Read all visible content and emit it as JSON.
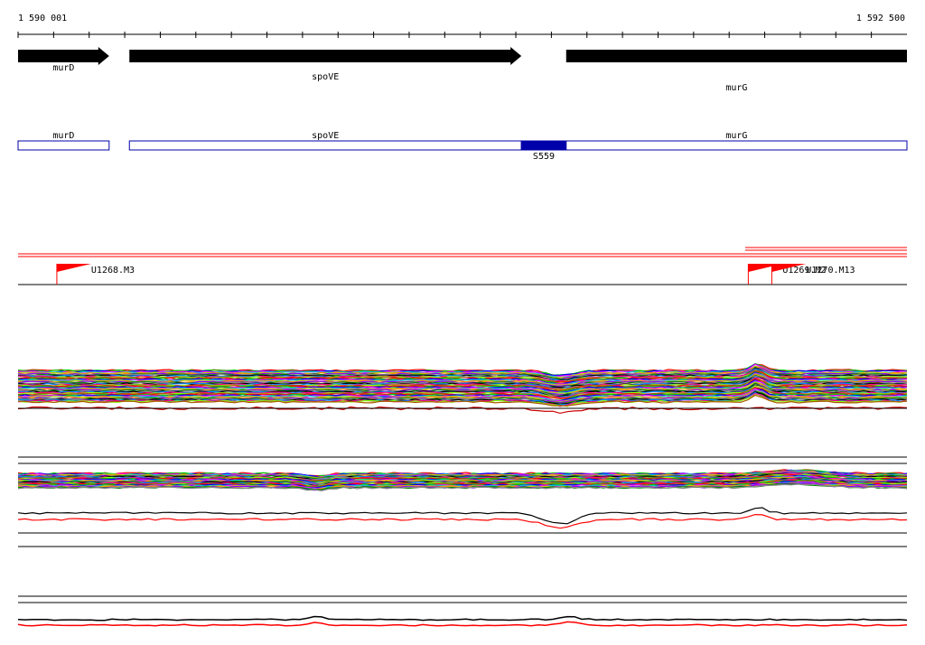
{
  "ruler": {
    "start_label": "1 590 001",
    "end_label": "1 592 500",
    "start": 1590001,
    "end": 1592500
  },
  "genes": [
    {
      "name": "murD",
      "start": 1590001,
      "end": 1590257,
      "strand": "+"
    },
    {
      "name": "spoVE",
      "start": 1590314,
      "end": 1591416,
      "strand": "+"
    },
    {
      "name": "murG",
      "start": 1591542,
      "end": 1592500,
      "strand": "+"
    }
  ],
  "segments": [
    {
      "name": "murD",
      "start": 1590001,
      "end": 1590257,
      "filled": false
    },
    {
      "name": "spoVE",
      "start": 1590314,
      "end": 1591416,
      "filled": false
    },
    {
      "name": "S559",
      "start": 1591416,
      "end": 1591542,
      "filled": true
    },
    {
      "name": "murG",
      "start": 1591542,
      "end": 1592500,
      "filled": false
    }
  ],
  "tss": [
    {
      "name": "U1268.M3",
      "pos": 1590110
    },
    {
      "name": "U1269.M2",
      "pos": 1592054
    },
    {
      "name": "U1270.M13",
      "pos": 1592120
    }
  ],
  "colors": {
    "gene_arrow": "#000000",
    "segment": "#0000aa",
    "tss": "#ff0000",
    "profile_palette": [
      "#ff0000",
      "#00cc00",
      "#0000ff",
      "#ff00ff",
      "#00cccc",
      "#cccc00",
      "#ff8800",
      "#8800ff",
      "#008800",
      "#888888",
      "#000000",
      "#0088ff",
      "#ff0088",
      "#88ff00",
      "#aa5500"
    ]
  }
}
